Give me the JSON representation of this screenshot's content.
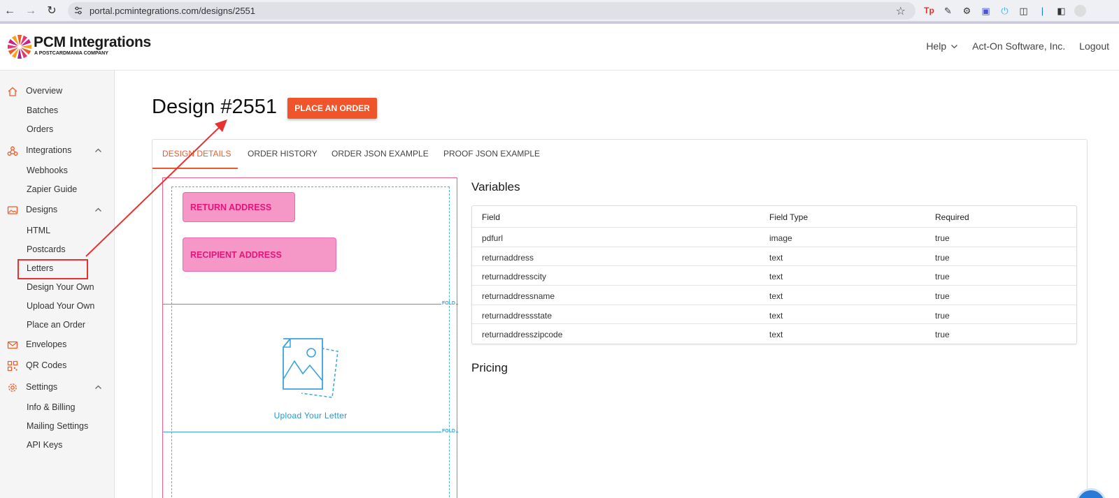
{
  "browser": {
    "url": "portal.pcmintegrations.com/designs/2551"
  },
  "brand": {
    "name": "PCM Integrations",
    "subtitle": "A POSTCARDMANIA COMPANY"
  },
  "header": {
    "help": "Help",
    "account": "Act-On Software, Inc.",
    "logout": "Logout"
  },
  "sidebar": {
    "overview": "Overview",
    "batches": "Batches",
    "orders": "Orders",
    "integrations": "Integrations",
    "webhooks": "Webhooks",
    "zapier": "Zapier Guide",
    "designs": "Designs",
    "html": "HTML",
    "postcards": "Postcards",
    "letters": "Letters",
    "design_your_own": "Design Your Own",
    "upload_your_own": "Upload Your Own",
    "place_an_order": "Place an Order",
    "envelopes": "Envelopes",
    "qr_codes": "QR Codes",
    "settings": "Settings",
    "info_billing": "Info & Billing",
    "mailing_settings": "Mailing Settings",
    "api_keys": "API Keys"
  },
  "page": {
    "title": "Design #2551",
    "order_button": "PLACE AN ORDER"
  },
  "tabs": {
    "design_details": "DESIGN DETAILS",
    "order_history": "ORDER HISTORY",
    "order_json": "ORDER JSON EXAMPLE",
    "proof_json": "PROOF JSON EXAMPLE"
  },
  "preview": {
    "return_address": "RETURN ADDRESS",
    "recipient_address": "RECIPIENT ADDRESS",
    "fold": "FOLD",
    "upload_text": "Upload Your Letter"
  },
  "variables": {
    "title": "Variables",
    "headers": [
      "Field",
      "Field Type",
      "Required"
    ],
    "rows": [
      [
        "pdfurl",
        "image",
        "true"
      ],
      [
        "returnaddress",
        "text",
        "true"
      ],
      [
        "returnaddresscity",
        "text",
        "true"
      ],
      [
        "returnaddressname",
        "text",
        "true"
      ],
      [
        "returnaddressstate",
        "text",
        "true"
      ],
      [
        "returnaddresszipcode",
        "text",
        "true"
      ]
    ]
  },
  "pricing": {
    "title": "Pricing"
  },
  "colors": {
    "accent": "#f0542a",
    "annotation_red": "#e53232",
    "address_pink": "#f598c8",
    "fold_blue": "#3aa3e0"
  }
}
